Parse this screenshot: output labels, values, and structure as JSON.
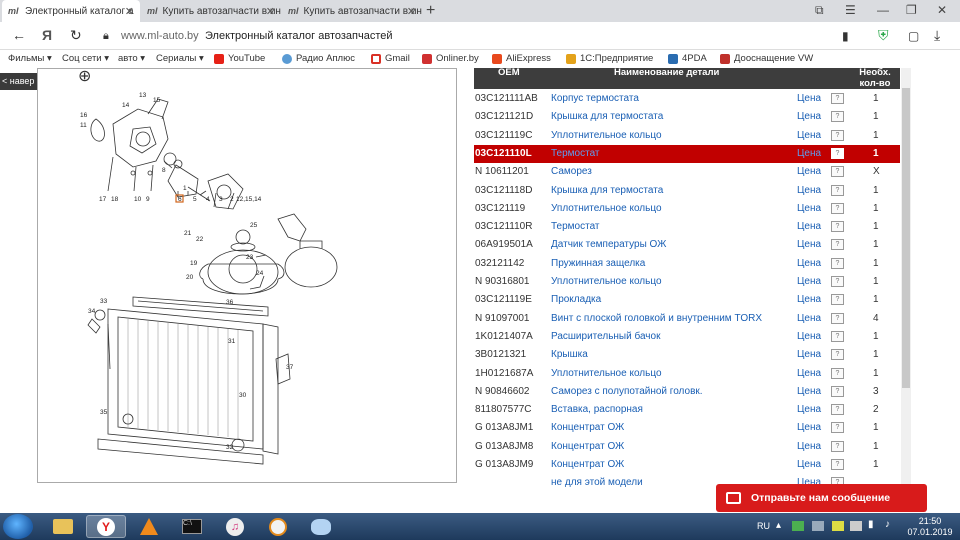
{
  "tabs": [
    {
      "title": "Электронный каталог а",
      "active": true
    },
    {
      "title": "Купить автозапчасти в инт",
      "active": false
    },
    {
      "title": "Купить автозапчасти в инт",
      "active": false
    }
  ],
  "address": {
    "url": "www.ml-auto.by",
    "page_title": "Электронный каталог автозапчастей"
  },
  "bookmarks": [
    {
      "label": "Фильмы",
      "has_arrow": true
    },
    {
      "label": "Соц сети",
      "has_arrow": true
    },
    {
      "label": "авто",
      "has_arrow": true
    },
    {
      "label": "Сериалы",
      "has_arrow": true
    },
    {
      "label": "YouTube",
      "color": "#e62117"
    },
    {
      "label": "Радио Аплюс",
      "color": "#5a9bd4"
    },
    {
      "label": "Gmail",
      "color": "#d93025"
    },
    {
      "label": "Onliner.by",
      "color": "#d03030"
    },
    {
      "label": "AliExpress",
      "color": "#e8491d"
    },
    {
      "label": "1С:Предприятие",
      "color": "#e3a21a"
    },
    {
      "label": "4PDA",
      "color": "#2a6cb0"
    },
    {
      "label": "Дооснащение VW",
      "color": "#c0312b"
    }
  ],
  "diagram": {
    "back_label": "навер",
    "callouts": [
      "11",
      "12",
      "13",
      "14",
      "15",
      "16",
      "17",
      "18",
      "10",
      "9",
      "8",
      "6",
      "5",
      "4",
      "3",
      "2",
      "1",
      "12,15,14",
      "25",
      "21",
      "22",
      "23",
      "24",
      "19",
      "20",
      "33",
      "34",
      "36",
      "31",
      "37",
      "30",
      "35",
      "32"
    ]
  },
  "parts_table": {
    "headers": {
      "oem": "OEM",
      "name": "Наименование детали",
      "qty": "Необх. кол-во"
    },
    "rows": [
      {
        "oem": "03C121111AB",
        "name": "Корпус термостата",
        "price": "Цена",
        "qty": "1"
      },
      {
        "oem": "03C121121D",
        "name": "Крышка для термостата",
        "price": "Цена",
        "qty": "1"
      },
      {
        "oem": "03C121119C",
        "name": "Уплотнительное кольцо",
        "price": "Цена",
        "qty": "1"
      },
      {
        "oem": "03C121110L",
        "name": "Термостат",
        "price": "Цена",
        "qty": "1",
        "selected": true
      },
      {
        "oem": "N 10611201",
        "name": "Саморез",
        "price": "Цена",
        "qty": "X"
      },
      {
        "oem": "03C121118D",
        "name": "Крышка для термостата",
        "price": "Цена",
        "qty": "1"
      },
      {
        "oem": "03C121119",
        "name": "Уплотнительное кольцо",
        "price": "Цена",
        "qty": "1"
      },
      {
        "oem": "03C121110R",
        "name": "Термостат",
        "price": "Цена",
        "qty": "1"
      },
      {
        "oem": "06A919501A",
        "name": "Датчик температуры ОЖ",
        "price": "Цена",
        "qty": "1"
      },
      {
        "oem": "032121142",
        "name": "Пружинная защелка",
        "price": "Цена",
        "qty": "1"
      },
      {
        "oem": "N 90316801",
        "name": "Уплотнительное кольцо",
        "price": "Цена",
        "qty": "1"
      },
      {
        "oem": "03C121119E",
        "name": "Прокладка",
        "price": "Цена",
        "qty": "1"
      },
      {
        "oem": "N 91097001",
        "name": "Винт с плоской головкой и внутренним TORX",
        "price": "Цена",
        "qty": "4"
      },
      {
        "oem": "1K0121407A",
        "name": "Расширительный бачок",
        "price": "Цена",
        "qty": "1"
      },
      {
        "oem": "3B0121321",
        "name": "Крышка",
        "price": "Цена",
        "qty": "1"
      },
      {
        "oem": "1H0121687A",
        "name": "Уплотнительное кольцо",
        "price": "Цена",
        "qty": "1"
      },
      {
        "oem": "N 90846602",
        "name": "Саморез с полупотайной головк.",
        "price": "Цена",
        "qty": "3"
      },
      {
        "oem": "811807577C",
        "name": "Вставка, распорная",
        "price": "Цена",
        "qty": "2"
      },
      {
        "oem": "G 013A8JM1",
        "name": "Концентрат ОЖ",
        "price": "Цена",
        "qty": "1"
      },
      {
        "oem": "G 013A8JM8",
        "name": "Концентрат ОЖ",
        "price": "Цена",
        "qty": "1"
      },
      {
        "oem": "G 013A8JM9",
        "name": "Концентрат ОЖ",
        "price": "Цена",
        "qty": "1"
      },
      {
        "oem": "",
        "name": "не для этой модели",
        "price": "Цена",
        "qty": ""
      }
    ]
  },
  "chat": {
    "label": "Отправьте нам сообщение"
  },
  "taskbar": {
    "lang": "RU",
    "time": "21:50",
    "date": "07.01.2019"
  },
  "colors": {
    "selected_row": "#c10000",
    "link": "#1a5fb4",
    "header_bg": "#3d3d3d",
    "chat_bg": "#d81b1b"
  }
}
